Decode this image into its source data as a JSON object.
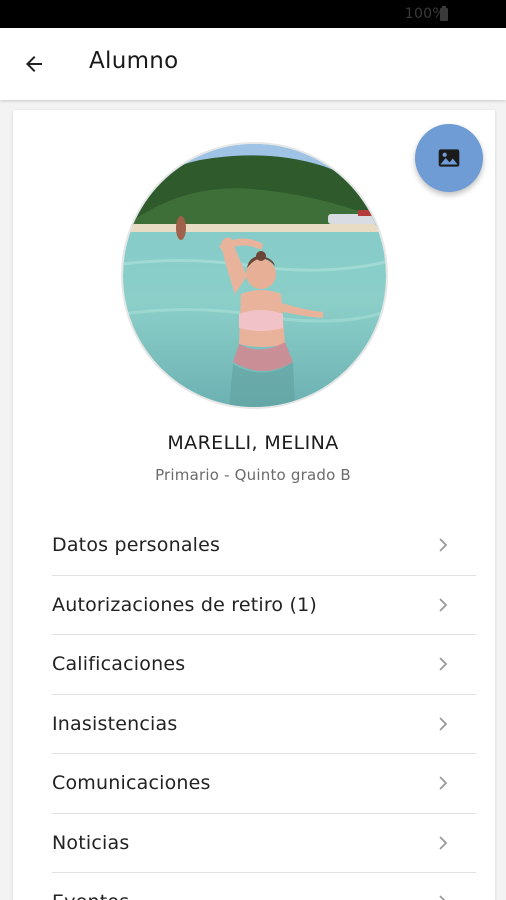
{
  "status_bar": {
    "battery_text": "100%",
    "battery_icon": "battery-icon"
  },
  "app_bar": {
    "title": "Alumno",
    "back_icon": "arrow-left-icon"
  },
  "fab": {
    "icon": "image-icon",
    "color": "#6f9cd4"
  },
  "profile": {
    "name": "MARELLI, MELINA",
    "grade": "Primario - Quinto grado B"
  },
  "menu": {
    "chevron_icon": "chevron-right-icon",
    "items": [
      {
        "label": "Datos personales"
      },
      {
        "label": "Autorizaciones de retiro (1)"
      },
      {
        "label": "Calificaciones"
      },
      {
        "label": "Inasistencias"
      },
      {
        "label": "Comunicaciones"
      },
      {
        "label": "Noticias"
      },
      {
        "label": "Eventos"
      }
    ]
  }
}
